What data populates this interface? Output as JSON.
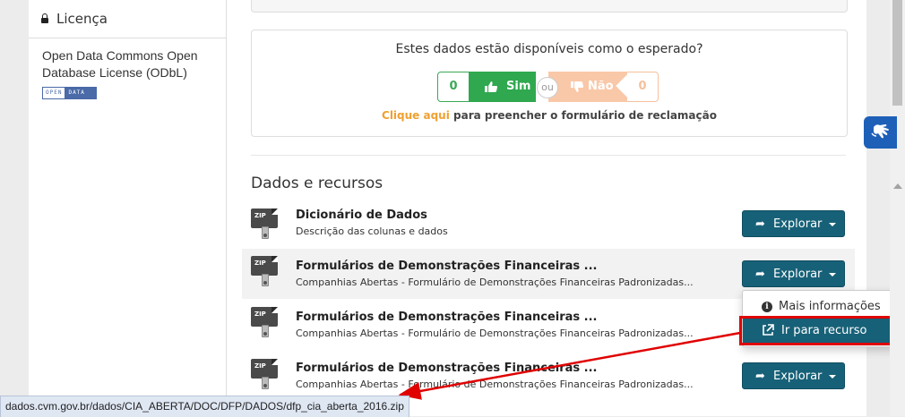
{
  "sidebar": {
    "license_heading": "Licença",
    "license_text": "Open Data Commons Open Database License (ODbL)",
    "badge_left": "OPEN",
    "badge_right": "DATA"
  },
  "feedback": {
    "question": "Estes dados estão disponíveis como o esperado?",
    "yes_count": "0",
    "yes_label": "Sim",
    "or_label": "ou",
    "no_label": "Não",
    "no_count": "0",
    "link_text": "Clique aqui",
    "link_rest": " para preencher o formulário de reclamação"
  },
  "resources": {
    "section_title": "Dados e recursos",
    "explore_label": "Explorar",
    "zip_label": "ZIP",
    "items": [
      {
        "title": "Dicionário de Dados",
        "description": "Descrição das colunas e dados"
      },
      {
        "title": "Formulários de Demonstrações Financeiras ...",
        "description": "Companhias Abertas - Formulário de Demonstrações Financeiras Padronizadas..."
      },
      {
        "title": "Formulários de Demonstrações Financeiras ...",
        "description": "Companhias Abertas - Formulário de Demonstrações Financeiras Padronizadas..."
      },
      {
        "title": "Formulários de Demonstrações Financeiras ...",
        "description": "Companhias Abertas - Formulário de Demonstrações Financeiras Padronizadas..."
      }
    ]
  },
  "dropdown": {
    "more_info": "Mais informações",
    "go_to_resource": "Ir para recurso"
  },
  "status_bar": {
    "url": "dados.cvm.gov.br/dados/CIA_ABERTA/DOC/DFP/DADOS/dfp_cia_aberta_2016.zip"
  },
  "colors": {
    "primary": "#176178",
    "yes_green": "#2fa84f",
    "no_orange": "#f9c8a8",
    "link_orange": "#f0a030",
    "annotation_red": "#e00000"
  }
}
